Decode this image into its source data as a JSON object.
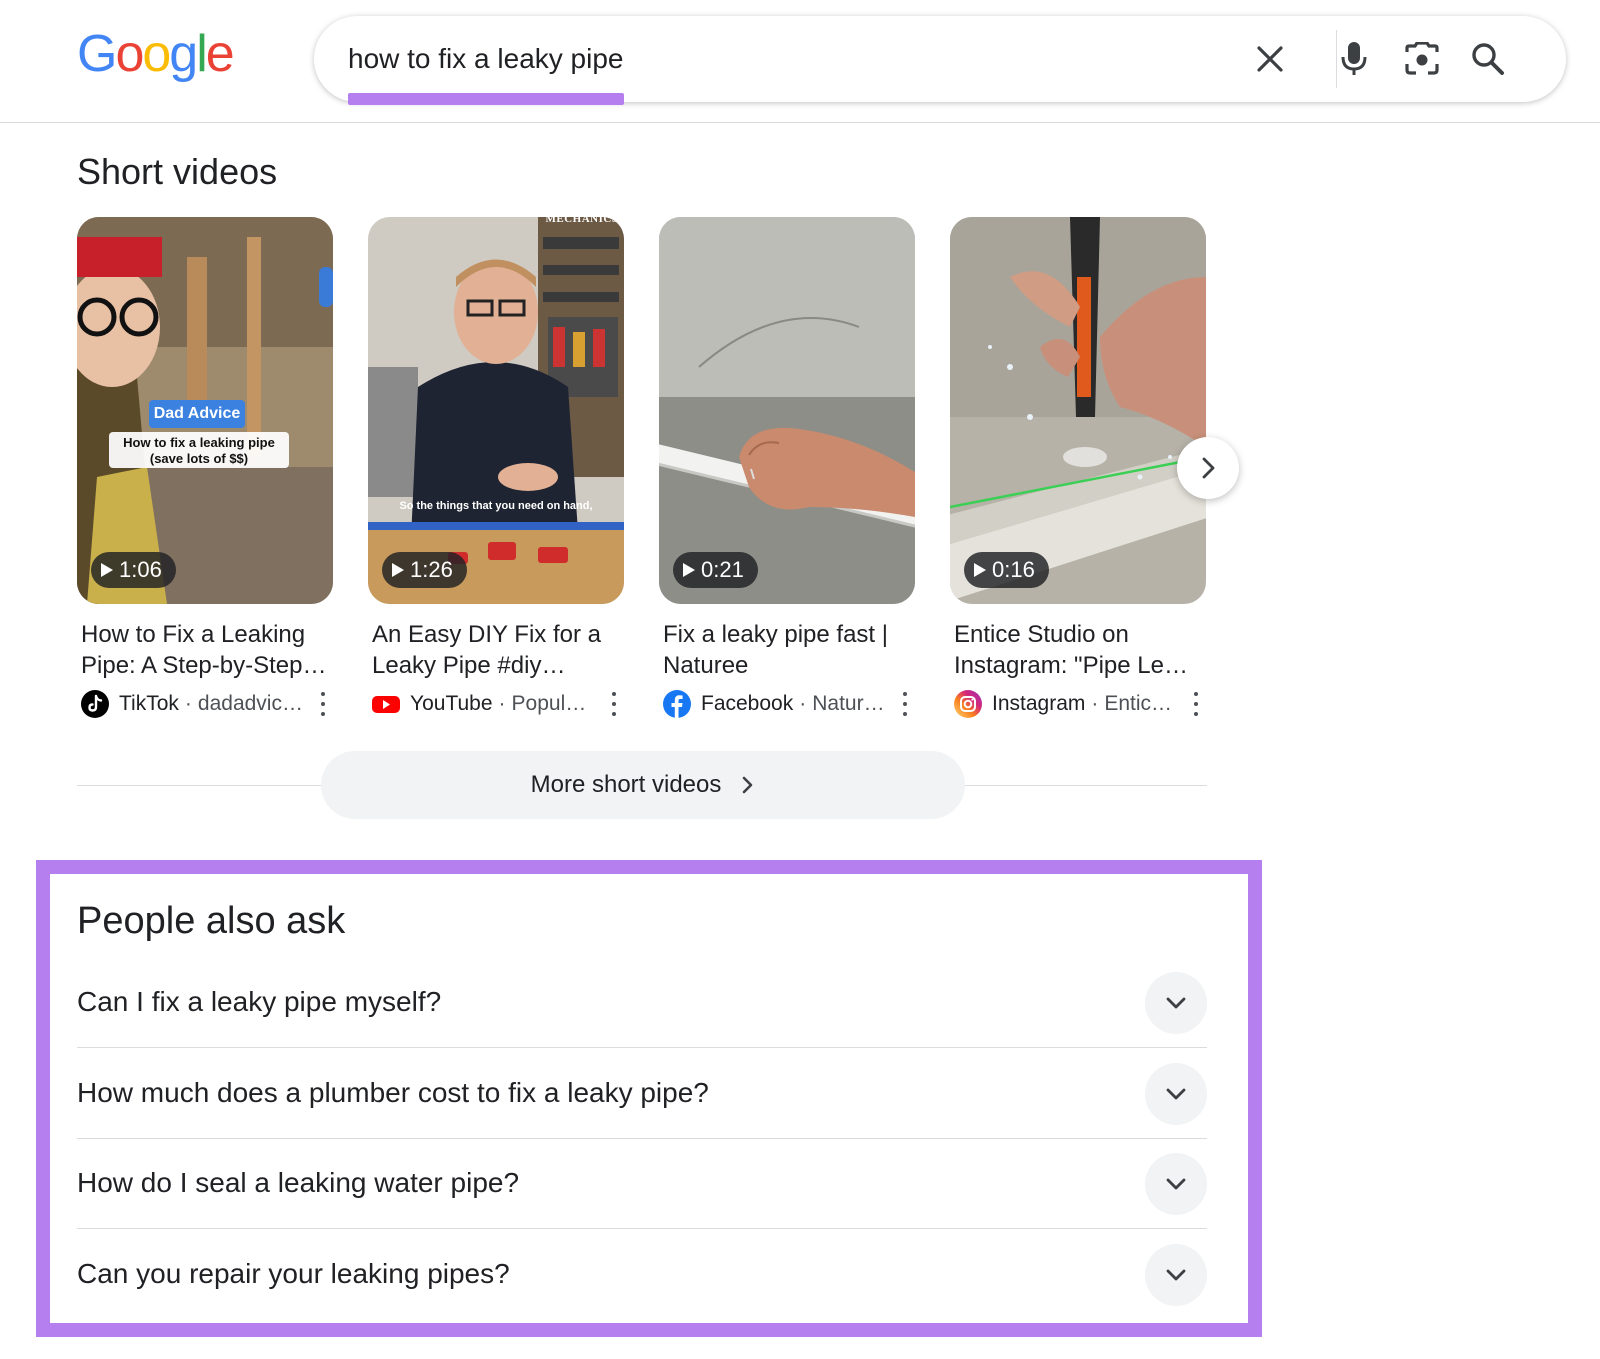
{
  "header": {
    "logo": [
      "G",
      "o",
      "o",
      "g",
      "l",
      "e"
    ],
    "logo_colors": [
      "#4285F4",
      "#EA4335",
      "#FBBC05",
      "#4285F4",
      "#34A853",
      "#EA4335"
    ],
    "search_query": "how to fix a leaky pipe",
    "icons": [
      "clear-icon",
      "microphone-icon",
      "lens-camera-icon",
      "search-icon"
    ],
    "underline_color": "#b57ff0"
  },
  "short_videos": {
    "title": "Short videos",
    "videos": [
      {
        "duration": "1:06",
        "title_line1": "How to Fix a Leaking",
        "title_line2": "Pipe: A Step-by-Step…",
        "source": "TikTok",
        "channel": "dadadvic…",
        "overlay_badge": "Dad Advice",
        "overlay_line1": "How to fix a leaking pipe",
        "overlay_line2": "(save lots of $$)"
      },
      {
        "duration": "1:26",
        "title_line1": "An Easy DIY Fix for a",
        "title_line2": "Leaky Pipe #diy…",
        "source": "YouTube",
        "channel": "Popul…",
        "overlay_caption": "So the things that you need on hand,",
        "overlay_sign": "MECHANICS"
      },
      {
        "duration": "0:21",
        "title_line1": "Fix a leaky pipe fast |",
        "title_line2": "Naturee",
        "source": "Facebook",
        "channel": "Natur…"
      },
      {
        "duration": "0:16",
        "title_line1": "Entice Studio on",
        "title_line2": "Instagram: \"Pipe Le…",
        "source": "Instagram",
        "channel": "Entic…"
      }
    ],
    "more_label": "More short videos"
  },
  "people_also_ask": {
    "title": "People also ask",
    "questions": [
      "Can I fix a leaky pipe myself?",
      "How much does a plumber cost to fix a leaky pipe?",
      "How do I seal a leaking water pipe?",
      "Can you repair your leaking pipes?"
    ],
    "highlight_color": "#b57ff0"
  }
}
